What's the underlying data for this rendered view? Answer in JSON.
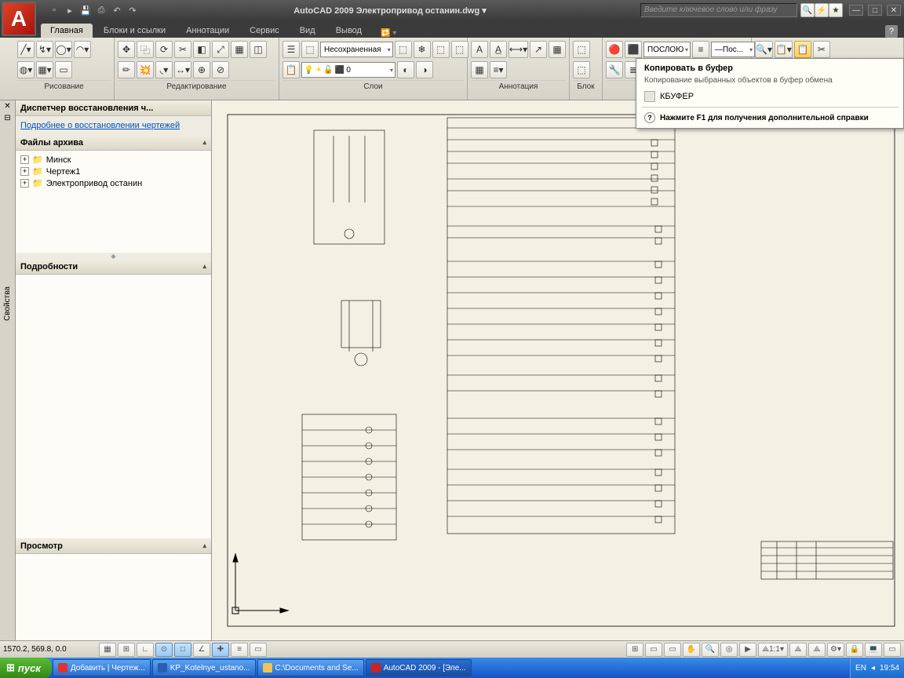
{
  "app": {
    "name": "AutoCAD 2009",
    "document": "Электропривод останин.dwg",
    "search_placeholder": "Введите ключевое слово или фразу"
  },
  "qat_icons": [
    "new",
    "open",
    "save",
    "print",
    "undo",
    "redo"
  ],
  "ribbon_tabs": [
    "Главная",
    "Блоки и ссылки",
    "Аннотации",
    "Сервис",
    "Вид",
    "Вывод"
  ],
  "ribbon_active_tab": "Главная",
  "panels": {
    "draw": "Рисование",
    "edit": "Редактирование",
    "layer": "Слои",
    "annotation": "Аннотация",
    "block": "Блок",
    "layer_state": "Несохраненная",
    "bylayer1": "ПОСЛОЮ",
    "bylayer2": "Пос..."
  },
  "side_tab": "Свойства",
  "recovery": {
    "title": "Диспетчер восстановления ч...",
    "link": "Подробнее о восстановлении чертежей",
    "archive_header": "Файлы архива",
    "files": [
      "Минск",
      "Чертеж1",
      "Электропривод останин"
    ],
    "details_header": "Подробности",
    "preview_header": "Просмотр"
  },
  "tooltip": {
    "title": "Копировать в буфер",
    "desc": "Копирование выбранных объектов в буфер обмена",
    "cmd": "КБУФЕР",
    "hint": "Нажмите F1 для получения дополнительной справки"
  },
  "status": {
    "coords": "1570.2, 569.8, 0.0",
    "scale": "1:1"
  },
  "taskbar": {
    "start": "пуск",
    "items": [
      "Добавить | Чертеж...",
      "KP_Kotelnye_ustano...",
      "C:\\Documents and Se...",
      "AutoCAD 2009 - [Эле..."
    ],
    "lang": "EN",
    "clock": "19:54"
  }
}
